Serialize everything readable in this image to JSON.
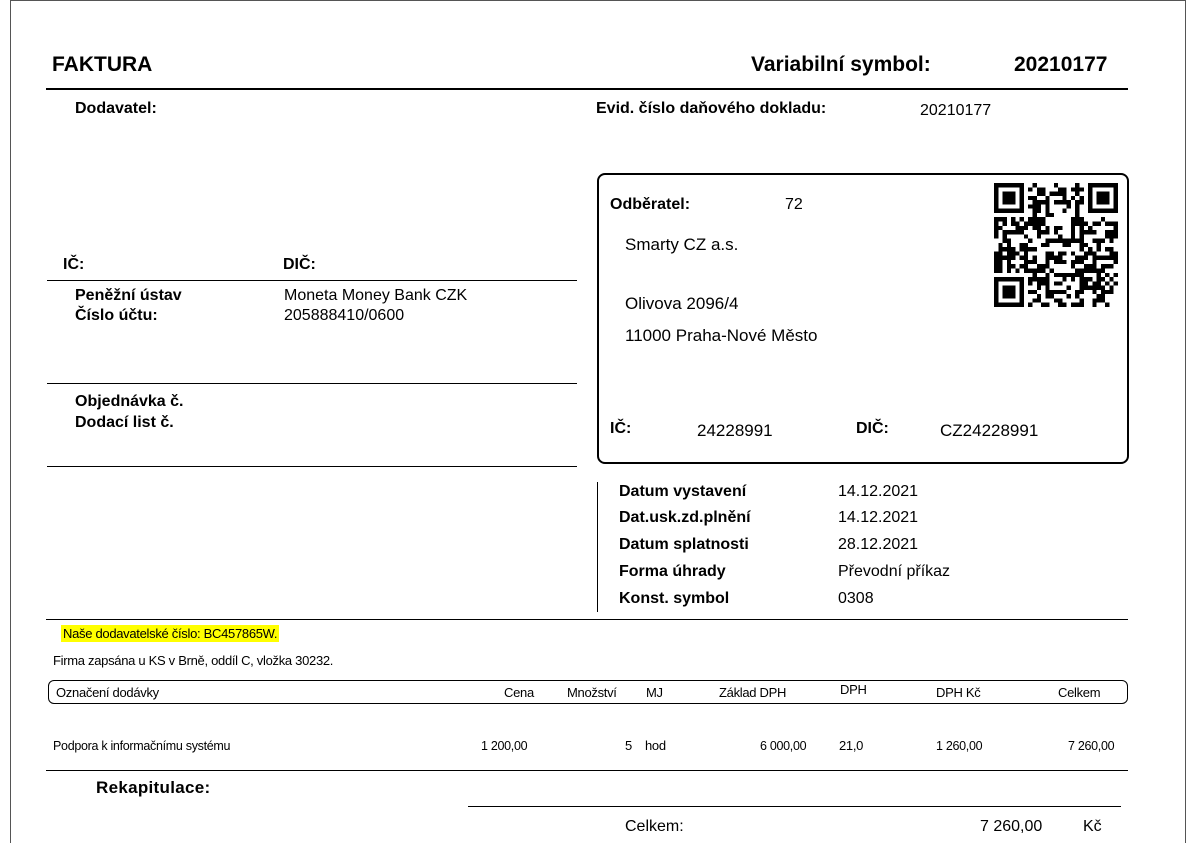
{
  "header": {
    "title": "FAKTURA",
    "variable_symbol_label": "Variabilní symbol:",
    "variable_symbol_value": "20210177"
  },
  "supplier": {
    "label": "Dodavatel:",
    "ic_label": "IČ:",
    "dic_label": "DIČ:",
    "bank_label": "Peněžní ústav",
    "bank_value": "Moneta Money Bank CZK",
    "account_label": "Číslo účtu:",
    "account_value": "205888410/0600",
    "order_label": "Objednávka  č.",
    "delivery_note_label": "Dodací list č."
  },
  "tax_doc": {
    "label": "Evid. číslo daňového dokladu:",
    "value": "20210177"
  },
  "customer": {
    "label": "Odběratel:",
    "number": "72",
    "name": "Smarty CZ a.s.",
    "street": "Olivova 2096/4",
    "city": "11000  Praha-Nové Město",
    "ic_label": "IČ:",
    "ic_value": "24228991",
    "dic_label": "DIČ:",
    "dic_value": "CZ24228991"
  },
  "dates": [
    {
      "label": "Datum vystavení",
      "value": "14.12.2021"
    },
    {
      "label": "Dat.usk.zd.plnění",
      "value": "14.12.2021"
    },
    {
      "label": "Datum splatnosti",
      "value": "28.12.2021"
    },
    {
      "label": "Forma úhrady",
      "value": "Převodní příkaz"
    },
    {
      "label": "Konst. symbol",
      "value": "0308"
    }
  ],
  "notes": {
    "supplier_number": "Naše dodavatelské číslo: BC457865W.",
    "registry": "Firma zapsána u KS v Brně, oddíl C, vložka 30232."
  },
  "items": {
    "columns": {
      "designation": "Označení dodávky",
      "price": "Cena",
      "quantity": "Množství",
      "unit": "MJ",
      "vat_base": "Základ DPH",
      "vat": "DPH",
      "vat_czk": "DPH Kč",
      "total": "Celkem"
    },
    "rows": [
      {
        "designation": "Podpora k informačnímu systému",
        "price": "1 200,00",
        "quantity": "5",
        "unit": "hod",
        "vat_base": "6 000,00",
        "vat": "21,0",
        "vat_czk": "1 260,00",
        "total": "7 260,00"
      }
    ]
  },
  "recap": {
    "title": "Rekapitulace:",
    "total_label": "Celkem:",
    "total_value": "7 260,00",
    "currency": "Kč"
  }
}
